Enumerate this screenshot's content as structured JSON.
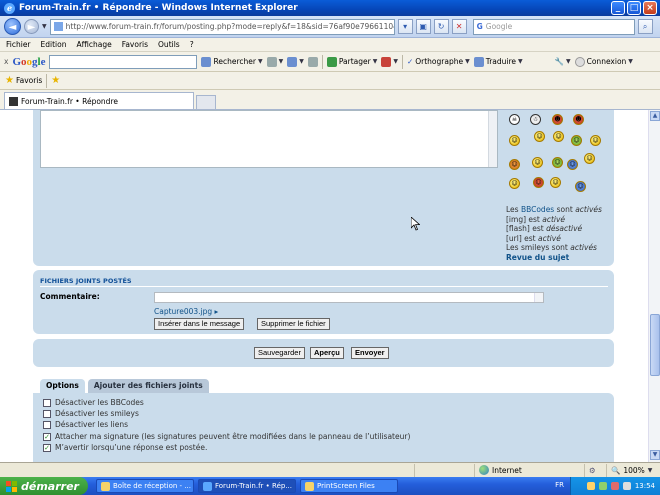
{
  "window": {
    "title": "Forum-Train.fr • Répondre - Windows Internet Explorer",
    "min": "_",
    "max": "□",
    "close": "×"
  },
  "address": {
    "url": "http://www.forum-train.fr/forum/posting.php?mode=reply&f=18&sid=76af90e79661104b982d2fd9bf67d5",
    "search_placeholder": "Google",
    "search_brand": "G"
  },
  "menu": [
    "Fichier",
    "Edition",
    "Affichage",
    "Favoris",
    "Outils",
    "?"
  ],
  "google_toolbar": {
    "close": "x",
    "brand": [
      "G",
      "o",
      "o",
      "g",
      "l",
      "e"
    ],
    "search_label": "Rechercher",
    "share_label": "Partager",
    "spell_label": "Orthographe",
    "translate_label": "Traduire",
    "connect_label": "Connexion"
  },
  "favorites": {
    "label": "Favoris"
  },
  "tab": {
    "title": "Forum-Train.fr • Répondre"
  },
  "sidebar": {
    "bbcodes_prefix": "Les ",
    "bbcodes_link": "BBCodes",
    "bbcodes_mid": " sont ",
    "bbcodes_state": "activés",
    "img_label": "[img] est ",
    "img_state": "activé",
    "flash_label": "[flash] est ",
    "flash_state": "désactivé",
    "url_label": "[url] est ",
    "url_state": "activé",
    "smileys_label": "Les smileys sont ",
    "smileys_state": "activés",
    "revue_link": "Revue du sujet"
  },
  "attachments": {
    "title": "Fichiers joints postés",
    "comment_label": "Commentaire:",
    "file_name": "Capture003.jpg",
    "insert_button": "Insérer dans le message",
    "delete_button": "Supprimer le fichier"
  },
  "submit": {
    "save": "Sauvegarder",
    "preview": "Aperçu",
    "send": "Envoyer"
  },
  "options_tabs": {
    "options": "Options",
    "attach": "Ajouter des fichiers joints"
  },
  "options": [
    {
      "label": "Désactiver les BBCodes",
      "checked": false
    },
    {
      "label": "Désactiver les smileys",
      "checked": false
    },
    {
      "label": "Désactiver les liens",
      "checked": false
    },
    {
      "label": "Attacher ma signature (les signatures peuvent être modifiées dans le panneau de l’utilisateur)",
      "checked": true
    },
    {
      "label": "M’avertir lorsqu’une réponse est postée.",
      "checked": true
    }
  ],
  "status": {
    "zone": "Internet",
    "zoom": "100%"
  },
  "taskbar": {
    "start": "démarrer",
    "tasks": [
      "Boîte de réception - ...",
      "Forum-Train.fr • Rép...",
      "PrintScreen Files"
    ],
    "lang": "FR",
    "clock": "13:54"
  },
  "colors": {
    "panel": "#cadceb",
    "link": "#105289",
    "titlebar": "#0a5cd8"
  }
}
